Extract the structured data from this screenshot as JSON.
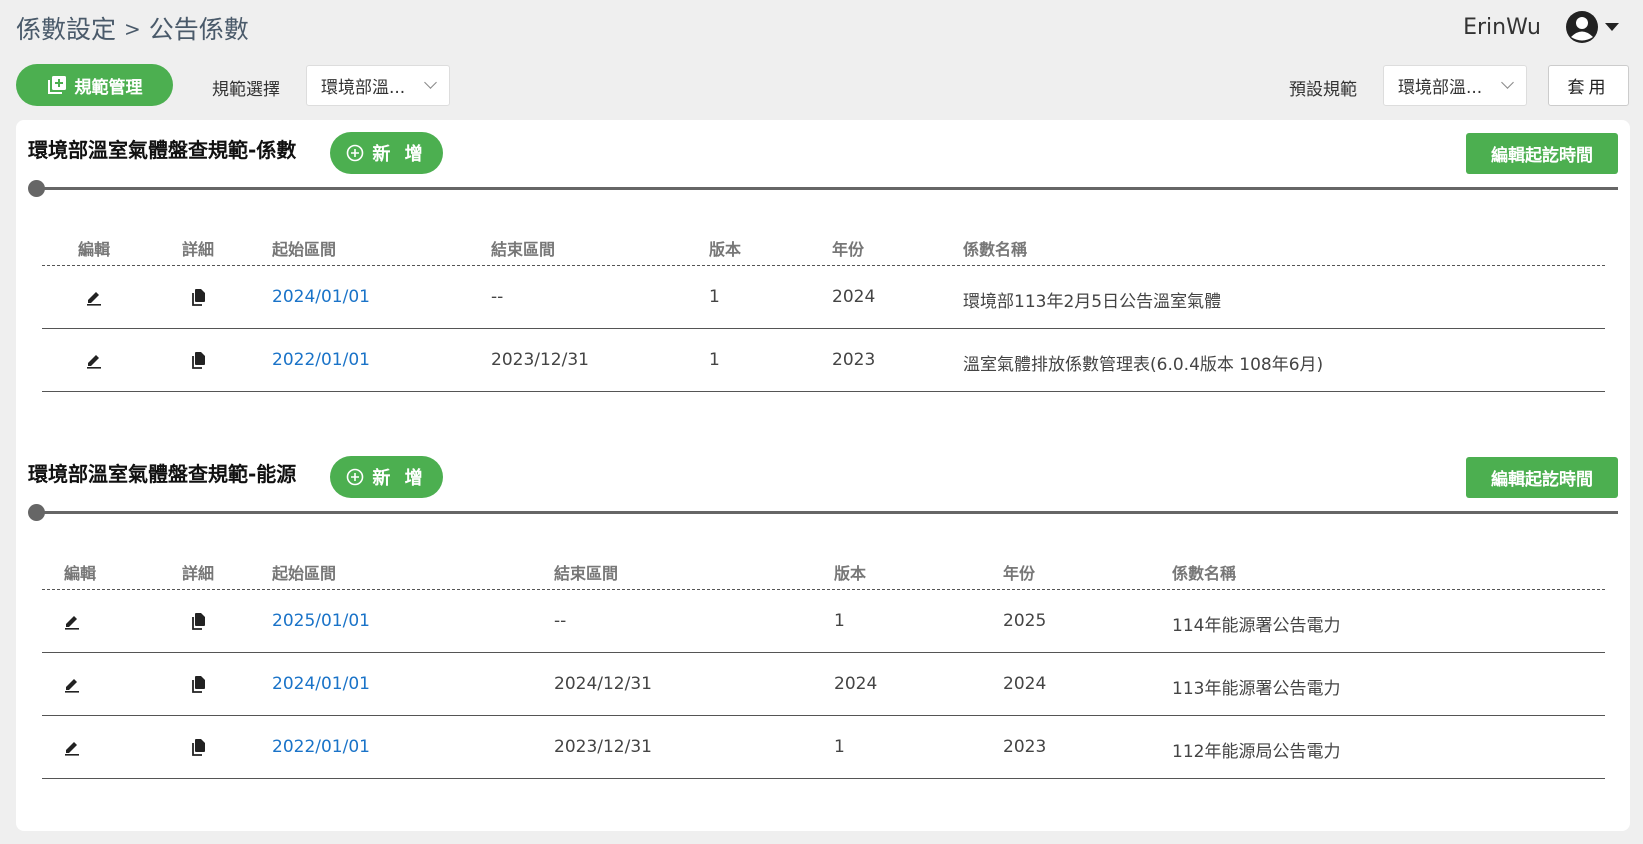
{
  "header": {
    "breadcrumb_parent": "係數設定",
    "breadcrumb_sep": ">",
    "breadcrumb_current": "公告係數",
    "user_name": "ErinWu"
  },
  "toolbar": {
    "rules_button": "規範管理",
    "rule_select_label": "規範選擇",
    "rule_select_value": "環境部溫...",
    "default_rule_label": "預設規範",
    "default_rule_value": "環境部溫...",
    "apply_button": "套用"
  },
  "colors": {
    "accent": "#4caf50",
    "link": "#1a73c8",
    "background": "#efefef"
  },
  "icons": [
    "plus-square-icon",
    "user-circle-icon",
    "caret-down-icon",
    "chevron-down-icon",
    "plus-circle-icon",
    "pencil-icon",
    "copy-icon"
  ],
  "sections": [
    {
      "title": "環境部溫室氣體盤查規範-係數",
      "add_button": "新 增",
      "edit_time_button": "編輯起訖時間",
      "columns": [
        "編輯",
        "詳細",
        "起始區間",
        "結束區間",
        "版本",
        "年份",
        "係數名稱"
      ],
      "rows": [
        [
          "2024/01/01",
          "--",
          "1",
          "2024",
          "環境部113年2月5日公告溫室氣體"
        ],
        [
          "2022/01/01",
          "2023/12/31",
          "1",
          "2023",
          "溫室氣體排放係數管理表(6.0.4版本 108年6月)"
        ]
      ]
    },
    {
      "title": "環境部溫室氣體盤查規範-能源",
      "add_button": "新 增",
      "edit_time_button": "編輯起訖時間",
      "columns": [
        "編輯",
        "詳細",
        "起始區間",
        "結束區間",
        "版本",
        "年份",
        "係數名稱"
      ],
      "rows": [
        [
          "2025/01/01",
          "--",
          "1",
          "2025",
          "114年能源署公告電力"
        ],
        [
          "2024/01/01",
          "2024/12/31",
          "2024",
          "2024",
          "113年能源署公告電力"
        ],
        [
          "2022/01/01",
          "2023/12/31",
          "1",
          "2023",
          "112年能源局公告電力"
        ]
      ]
    }
  ]
}
